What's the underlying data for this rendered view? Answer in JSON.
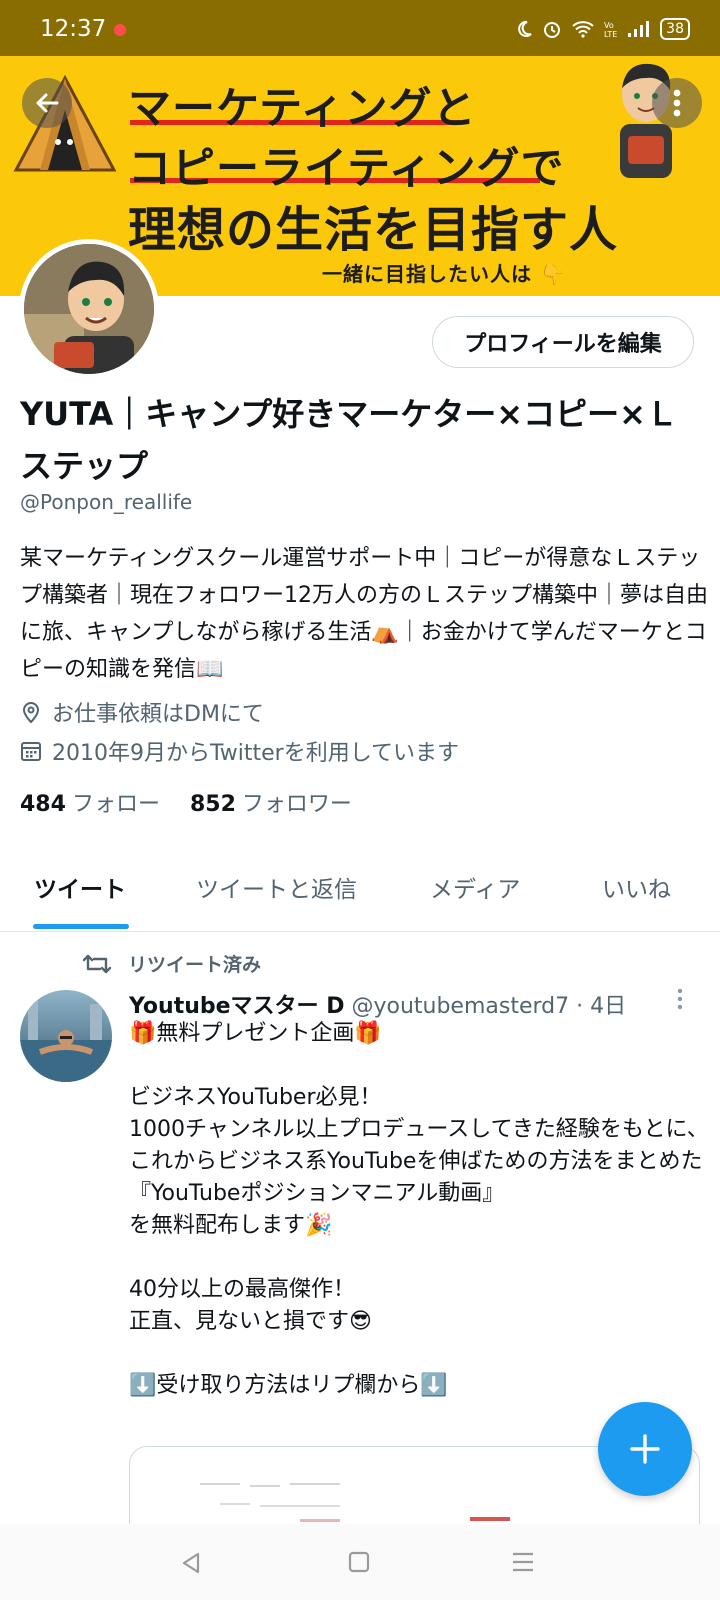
{
  "status_bar": {
    "time": "12:37",
    "battery": "38",
    "icons": [
      "moon-icon",
      "alarm-icon",
      "wifi-icon",
      "volte-icon",
      "signal-icon",
      "battery-icon"
    ]
  },
  "banner": {
    "line1": "マーケティングと",
    "line2": "コピーライティングで",
    "line3": "理想の生活を目指す人",
    "line4": "一緒に目指したい人は 👇",
    "background": "#fcc80a"
  },
  "profile": {
    "edit_button": "プロフィールを編集",
    "display_name": "YUTA｜キャンプ好きマーケター×コピー×Ｌステップ",
    "handle": "@Ponpon_reallife",
    "bio": "某マーケティングスクール運営サポート中｜コピーが得意なＬステップ構築者｜現在フォロワー12万人の方のＬステップ構築中｜夢は自由に旅、キャンプしながら稼げる生活⛺｜お金かけて学んだマーケとコピーの知識を発信📖",
    "location": "お仕事依頼はDMにて",
    "joined": "2010年9月からTwitterを利用しています",
    "following_count": "484",
    "following_label": "フォロー",
    "followers_count": "852",
    "followers_label": "フォロワー"
  },
  "tabs": [
    {
      "label": "ツイート",
      "active": true
    },
    {
      "label": "ツイートと返信",
      "active": false
    },
    {
      "label": "メディア",
      "active": false
    },
    {
      "label": "いいね",
      "active": false
    }
  ],
  "tweet": {
    "retweet_label": "リツイート済み",
    "author_name": "Youtubeマスター D",
    "author_handle": "@youtubemasterd7",
    "time": "· 4日",
    "body": "🎁無料プレゼント企画🎁\n\nビジネスYouTuber必見！\n1000チャンネル以上プロデュースしてきた経験をもとに、これからビジネス系YouTubeを伸ばための方法をまとめた\n『YouTubeポジションマニアル動画』\nを無料配布します🎉\n\n40分以上の最高傑作！\n正直、見ないと損です😎\n\n⬇️受け取り方法はリプ欄から⬇️"
  },
  "colors": {
    "accent": "#1d9bf0",
    "status_bar": "#8a6d00",
    "banner_underline": "#e0261c"
  }
}
